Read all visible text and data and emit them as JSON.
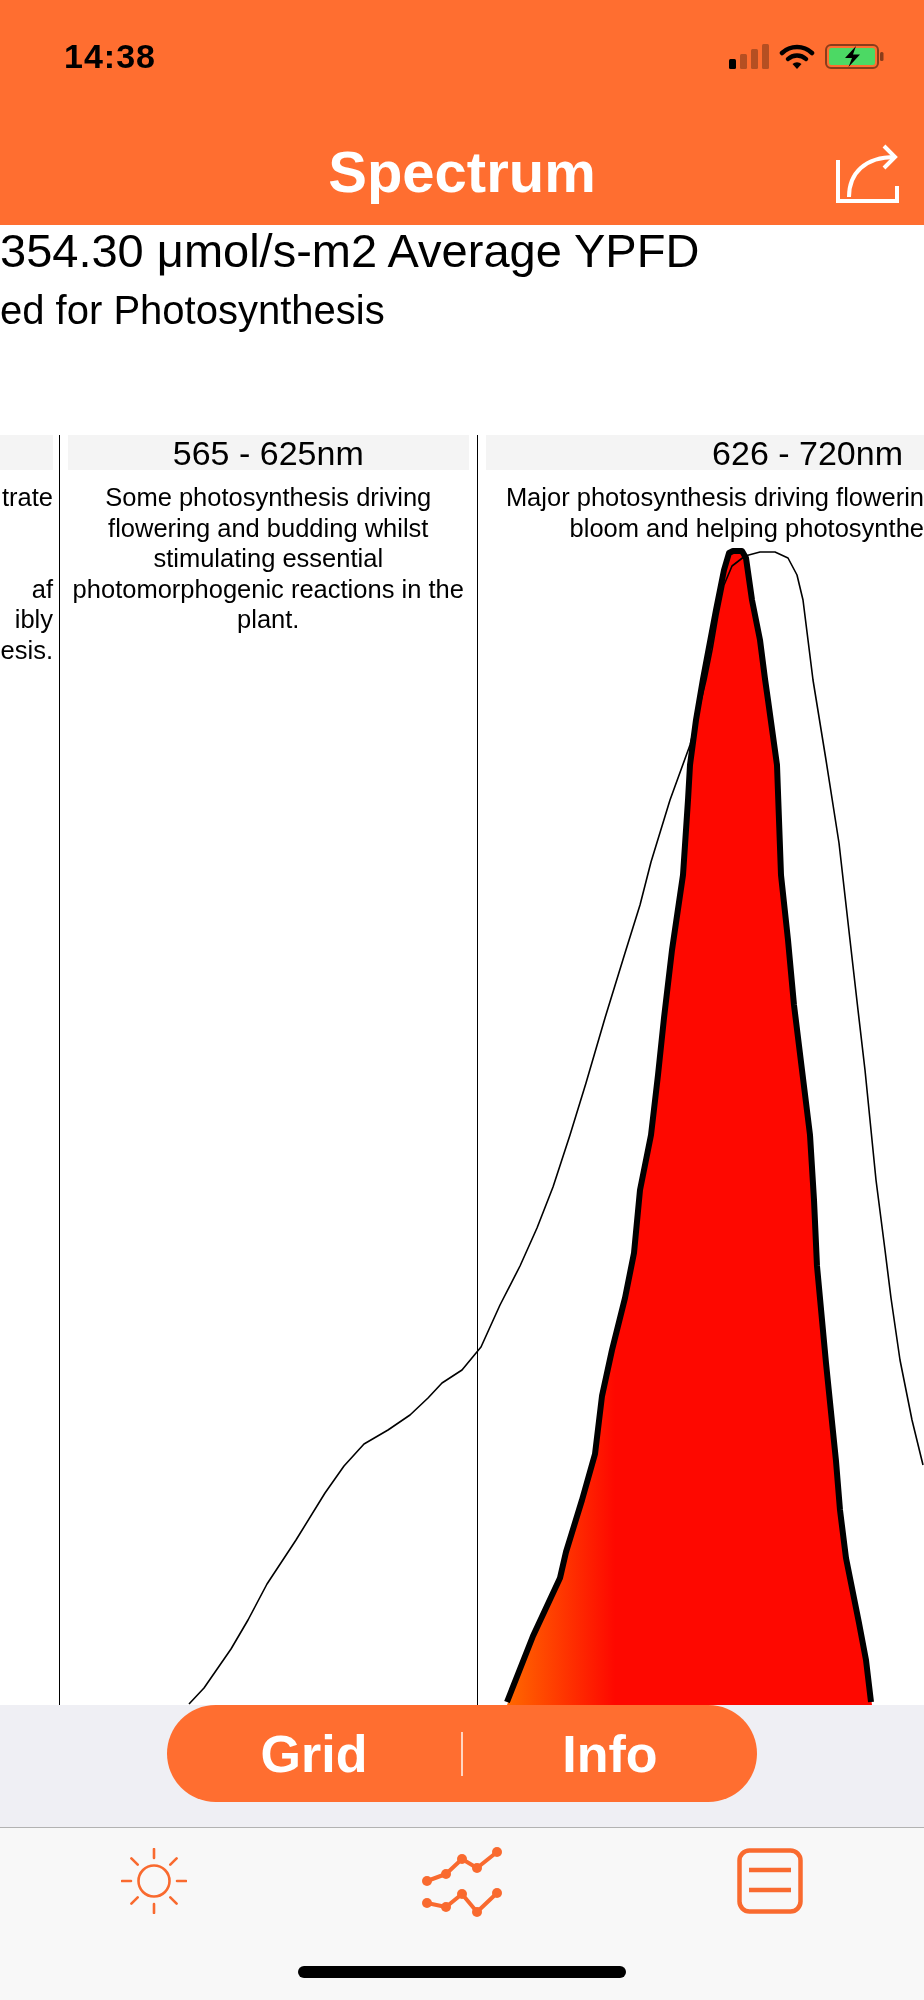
{
  "status_bar": {
    "time": "14:38"
  },
  "nav_bar": {
    "title": "Spectrum"
  },
  "summary": {
    "reading": "354.30 μmol/s-m2 Average YPFD",
    "note": "ed for Photosynthesis"
  },
  "spectrum_bands": [
    {
      "description": "trate\n\n\naf\nibly\nesis."
    },
    {
      "range": "565 - 625nm",
      "description": "Some photosynthesis driving flowering and budding whilst stimulating essential photomorphogenic reactions in the plant."
    },
    {
      "range": "626 - 720nm",
      "description": "Major photosynthesis driving flowerin\nbloom and helping photosynthe"
    }
  ],
  "segmented_control": {
    "segments": [
      {
        "label": "Grid"
      },
      {
        "label": "Info"
      }
    ]
  },
  "tab_bar": {
    "items": [
      {
        "kind": "sun"
      },
      {
        "kind": "chart"
      },
      {
        "kind": "list"
      }
    ]
  }
}
